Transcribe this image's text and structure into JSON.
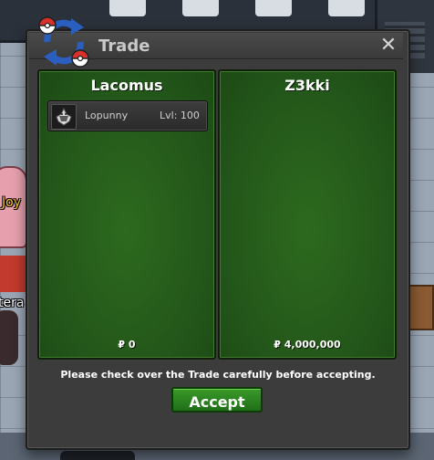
{
  "window": {
    "title": "Trade",
    "close_label": "✕"
  },
  "left_panel": {
    "player_name": "Lacomus",
    "pokemon": [
      {
        "name": "Lopunny",
        "level": "Lvl: 100"
      }
    ],
    "money": "₽ 0"
  },
  "right_panel": {
    "player_name": "Z3kki",
    "pokemon": [],
    "money": "₽ 4,000,000"
  },
  "notice": "Please check over the Trade carefully before accepting.",
  "accept_label": "Accept",
  "background_labels": {
    "npc_1": "Joy",
    "npc_2": "tera"
  },
  "colors": {
    "panel_green": "#23561a",
    "accept_green": "#2a8420",
    "window_gray": "#3c3c3c",
    "npc_name_yellow": "#f5c43a"
  }
}
